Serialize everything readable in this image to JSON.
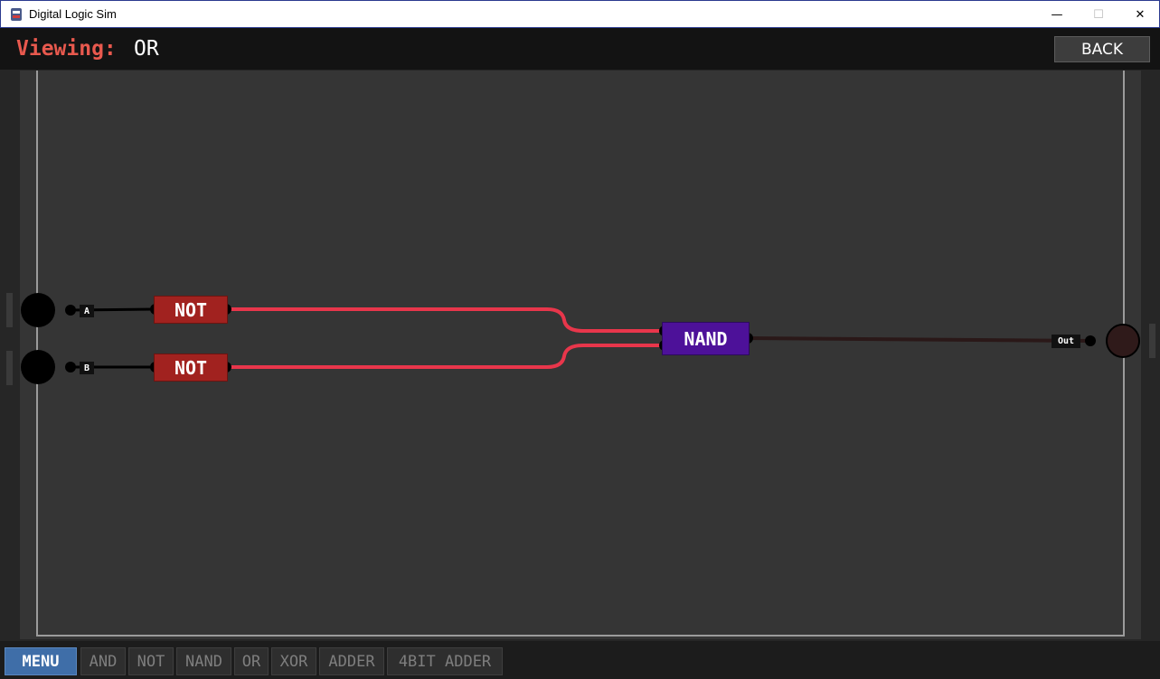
{
  "window": {
    "title": "Digital Logic Sim",
    "icon": "app-chip-icon",
    "controls": {
      "minimize": "—",
      "maximize": "☐",
      "close": "✕"
    }
  },
  "header": {
    "viewing_label": "Viewing:",
    "viewing_value": "OR",
    "back_label": "BACK"
  },
  "circuit": {
    "inputs": [
      {
        "label": "A",
        "state": "off"
      },
      {
        "label": "B",
        "state": "off"
      }
    ],
    "gates": [
      {
        "type": "NOT",
        "label": "NOT",
        "color": "#a1221f"
      },
      {
        "type": "NOT",
        "label": "NOT",
        "color": "#a1221f"
      },
      {
        "type": "NAND",
        "label": "NAND",
        "color": "#4d1199"
      }
    ],
    "outputs": [
      {
        "label": "Out",
        "state": "off"
      }
    ],
    "wire_colors": {
      "on": "#e8364b",
      "off": "#2a1818",
      "disconnected": "#000000"
    }
  },
  "bottom_bar": {
    "menu_label": "MENU",
    "chips": [
      "AND",
      "NOT",
      "NAND",
      "OR",
      "XOR",
      "ADDER",
      "4BIT ADDER"
    ]
  },
  "colors": {
    "accent": "#e8594e",
    "menu": "#3f6ea8",
    "background": "#353535"
  }
}
